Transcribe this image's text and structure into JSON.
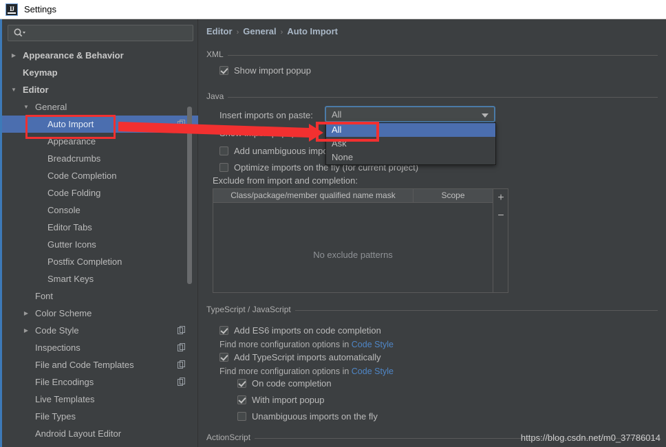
{
  "window": {
    "title": "Settings",
    "app_icon": "intellij-idea-icon",
    "accent_blue": "#3d7ab8",
    "selection_blue": "#4b6eaf",
    "annotation_red": "#f23030",
    "link_blue": "#4f86c6",
    "background": "#3c3f41"
  },
  "sidebar": {
    "search": {
      "value": "",
      "placeholder": "",
      "icon": "search-icon"
    },
    "items": [
      {
        "label": "Appearance & Behavior",
        "depth": 0,
        "arrow": "collapsed",
        "bold": true,
        "selected": false,
        "copy": false
      },
      {
        "label": "Keymap",
        "depth": 0,
        "arrow": "none",
        "bold": true,
        "selected": false,
        "copy": false
      },
      {
        "label": "Editor",
        "depth": 0,
        "arrow": "expanded",
        "bold": true,
        "selected": false,
        "copy": false
      },
      {
        "label": "General",
        "depth": 1,
        "arrow": "expanded",
        "bold": false,
        "selected": false,
        "copy": false
      },
      {
        "label": "Auto Import",
        "depth": 2,
        "arrow": "none",
        "bold": false,
        "selected": true,
        "copy": true
      },
      {
        "label": "Appearance",
        "depth": 2,
        "arrow": "none",
        "bold": false,
        "selected": false,
        "copy": false
      },
      {
        "label": "Breadcrumbs",
        "depth": 2,
        "arrow": "none",
        "bold": false,
        "selected": false,
        "copy": false
      },
      {
        "label": "Code Completion",
        "depth": 2,
        "arrow": "none",
        "bold": false,
        "selected": false,
        "copy": false
      },
      {
        "label": "Code Folding",
        "depth": 2,
        "arrow": "none",
        "bold": false,
        "selected": false,
        "copy": false
      },
      {
        "label": "Console",
        "depth": 2,
        "arrow": "none",
        "bold": false,
        "selected": false,
        "copy": false
      },
      {
        "label": "Editor Tabs",
        "depth": 2,
        "arrow": "none",
        "bold": false,
        "selected": false,
        "copy": false
      },
      {
        "label": "Gutter Icons",
        "depth": 2,
        "arrow": "none",
        "bold": false,
        "selected": false,
        "copy": false
      },
      {
        "label": "Postfix Completion",
        "depth": 2,
        "arrow": "none",
        "bold": false,
        "selected": false,
        "copy": false
      },
      {
        "label": "Smart Keys",
        "depth": 2,
        "arrow": "none",
        "bold": false,
        "selected": false,
        "copy": false
      },
      {
        "label": "Font",
        "depth": 1,
        "arrow": "none",
        "bold": false,
        "selected": false,
        "copy": false
      },
      {
        "label": "Color Scheme",
        "depth": 1,
        "arrow": "collapsed",
        "bold": false,
        "selected": false,
        "copy": false
      },
      {
        "label": "Code Style",
        "depth": 1,
        "arrow": "collapsed",
        "bold": false,
        "selected": false,
        "copy": true
      },
      {
        "label": "Inspections",
        "depth": 1,
        "arrow": "none",
        "bold": false,
        "selected": false,
        "copy": true
      },
      {
        "label": "File and Code Templates",
        "depth": 1,
        "arrow": "none",
        "bold": false,
        "selected": false,
        "copy": true
      },
      {
        "label": "File Encodings",
        "depth": 1,
        "arrow": "none",
        "bold": false,
        "selected": false,
        "copy": true
      },
      {
        "label": "Live Templates",
        "depth": 1,
        "arrow": "none",
        "bold": false,
        "selected": false,
        "copy": false
      },
      {
        "label": "File Types",
        "depth": 1,
        "arrow": "none",
        "bold": false,
        "selected": false,
        "copy": false
      },
      {
        "label": "Android Layout Editor",
        "depth": 1,
        "arrow": "none",
        "bold": false,
        "selected": false,
        "copy": false
      }
    ]
  },
  "breadcrumb": {
    "items": [
      "Editor",
      "General",
      "Auto Import"
    ],
    "separator": "›"
  },
  "main": {
    "sections": {
      "xml": {
        "title": "XML",
        "show_import_popup": {
          "label": "Show import popup",
          "checked": true
        }
      },
      "java": {
        "title": "Java",
        "insert_imports_label": "Insert imports on paste:",
        "insert_imports_value": "All",
        "show_popup_label": "Show import popup for:",
        "add_unambiguous": {
          "label": "Add unambiguous imports on the fly",
          "checked": false
        },
        "optimize_on_fly": {
          "label": "Optimize imports on the fly (for current project)",
          "checked": false
        },
        "exclude_label": "Exclude from import and completion:",
        "table": {
          "columns": [
            "Class/package/member qualified name mask",
            "Scope"
          ],
          "rows": [],
          "empty_message": "No exclude patterns",
          "add_button": "+",
          "remove_button": "−"
        }
      },
      "ts_js": {
        "title": "TypeScript / JavaScript",
        "add_es6": {
          "label": "Add ES6 imports on code completion",
          "checked": true
        },
        "hint1_prefix": "Find more configuration options in ",
        "hint1_link": "Code Style",
        "add_ts": {
          "label": "Add TypeScript imports automatically",
          "checked": true
        },
        "hint2_prefix": "Find more configuration options in ",
        "hint2_link": "Code Style",
        "on_code_completion": {
          "label": "On code completion",
          "checked": true
        },
        "with_import_popup": {
          "label": "With import popup",
          "checked": true
        },
        "unambiguous_on_fly": {
          "label": "Unambiguous imports on the fly",
          "checked": false
        }
      },
      "actionscript": {
        "title": "ActionScript"
      }
    },
    "dropdown": {
      "open": true,
      "options": [
        "All",
        "Ask",
        "None"
      ],
      "selected": "All"
    }
  },
  "watermark": "https://blog.csdn.net/m0_37786014"
}
